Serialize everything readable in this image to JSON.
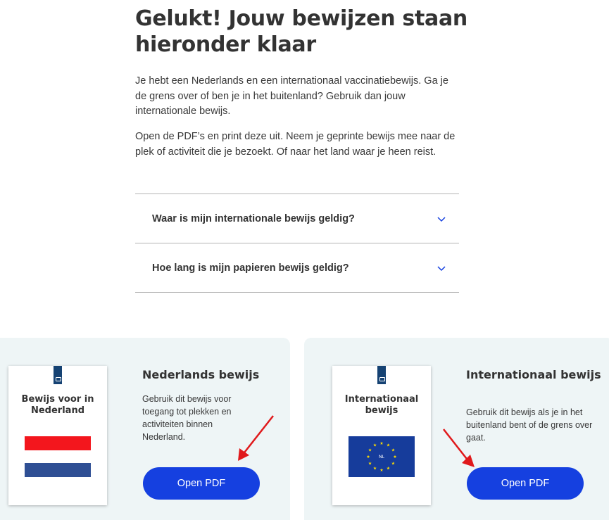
{
  "page": {
    "title": "Gelukt! Jouw bewijzen staan hieronder klaar",
    "intro_1": "Je hebt een Nederlands en een internationaal vaccinatiebewijs. Ga je de grens over of ben je in het buitenland? Gebruik dan jouw internationale bewijs.",
    "intro_2": "Open de PDF’s en print deze uit. Neem je geprinte bewijs mee naar de plek of activiteit die je bezoekt. Of naar het land waar je heen reist."
  },
  "accordion": [
    {
      "label": "Waar is mijn internationale bewijs geldig?",
      "icon": "chevron-down-icon"
    },
    {
      "label": "Hoe lang is mijn papieren bewijs geldig?",
      "icon": "chevron-down-icon"
    }
  ],
  "cards": {
    "dutch": {
      "cert_title": "Bewijs voor in Nederland",
      "heading": "Nederlands bewijs",
      "text": "Gebruik dit bewijs voor toegang tot plekken en activiteiten binnen Nederland.",
      "button": "Open PDF"
    },
    "international": {
      "cert_title": "Internationaal bewijs",
      "heading": "Internationaal bewijs",
      "text": "Gebruik dit bewijs als je in het buitenland bent of de grens over gaat.",
      "button": "Open PDF",
      "flag_label": "NL"
    }
  },
  "colors": {
    "primary_button": "#1540e0",
    "card_background": "#eef5f6",
    "annotation_arrow": "#e0191b",
    "flag_red": "#f3161d",
    "flag_blue": "#2f4f94",
    "eu_blue": "#163c9b",
    "eu_star": "#ffde00"
  }
}
